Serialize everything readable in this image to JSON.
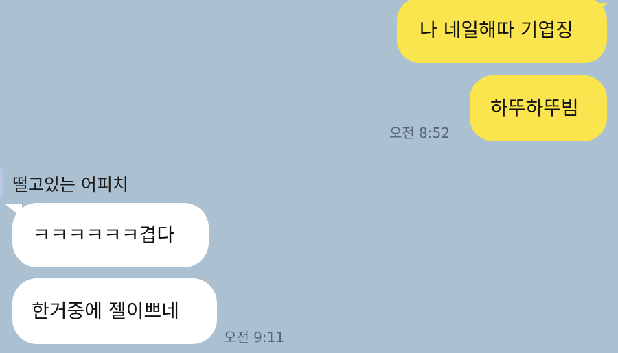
{
  "chat": {
    "my_messages": [
      {
        "text": "나 네일해따 기엽징"
      },
      {
        "text": "하뚜하뚜빔"
      }
    ],
    "my_time": "오전 8:52",
    "sender_name": "떨고있는 어피치",
    "their_messages": [
      {
        "text": "ㅋㅋㅋㅋㅋㅋ겹다"
      },
      {
        "text": "한거중에 젤이쁘네"
      }
    ],
    "their_time": "오전 9:11"
  },
  "colors": {
    "background": "#abc1d1",
    "my_bubble": "#fbe54e",
    "their_bubble": "#ffffff",
    "timestamp": "#556574"
  }
}
